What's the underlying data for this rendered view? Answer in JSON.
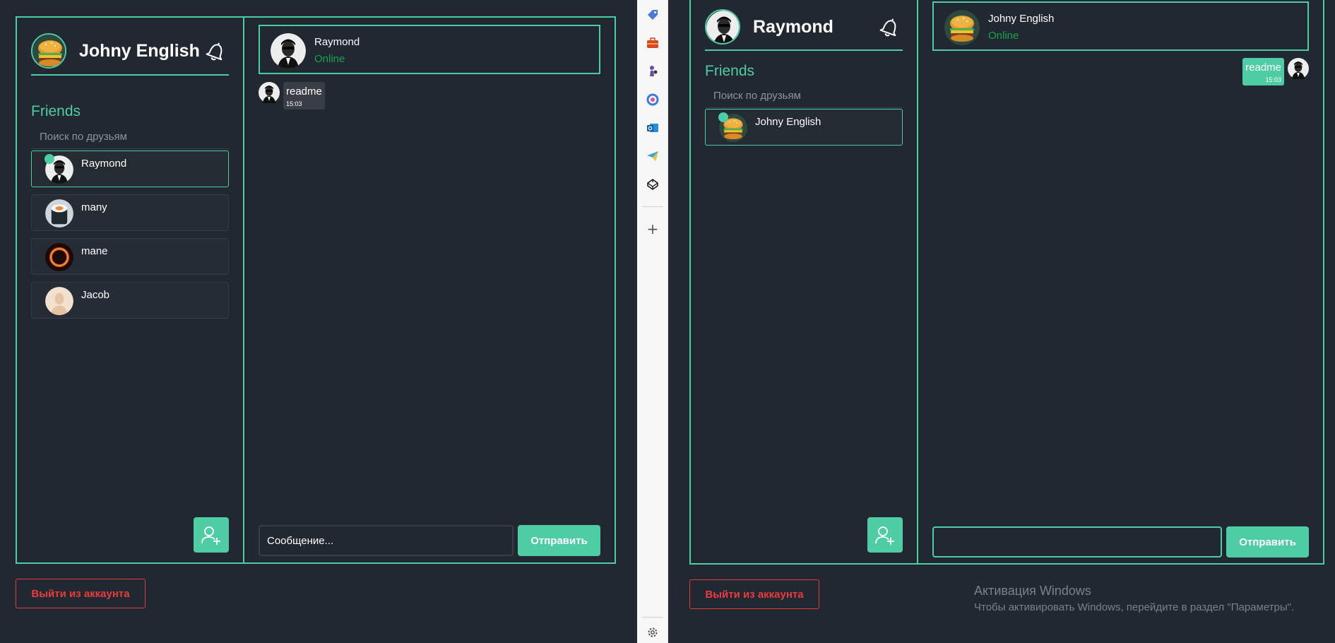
{
  "left": {
    "user_name": "Johny English",
    "friends_title": "Friends",
    "search_placeholder": "Поиск по друзьям",
    "friends": [
      {
        "name": "Raymond",
        "online": true,
        "active": true
      },
      {
        "name": "many",
        "online": false,
        "active": false
      },
      {
        "name": "mane",
        "online": false,
        "active": false
      },
      {
        "name": "Jacob",
        "online": false,
        "active": false
      }
    ],
    "chat": {
      "contact_name": "Raymond",
      "contact_status": "Online",
      "messages": [
        {
          "text": "readme",
          "time": "15:03",
          "direction": "in"
        }
      ],
      "input_placeholder": "Сообщение...",
      "input_value": "",
      "send_label": "Отправить"
    },
    "logout_label": "Выйти из аккаунта"
  },
  "right": {
    "user_name": "Raymond",
    "friends_title": "Friends",
    "search_placeholder": "Поиск по друзьям",
    "friends": [
      {
        "name": "Johny English",
        "online": true,
        "active": true
      }
    ],
    "chat": {
      "contact_name": "Johny English",
      "contact_status": "Online",
      "messages": [
        {
          "text": "readme",
          "time": "15:03",
          "direction": "out"
        }
      ],
      "input_placeholder": "",
      "input_value": "",
      "send_label": "Отправить"
    },
    "logout_label": "Выйти из аккаунта"
  },
  "edge_sidebar": {
    "icons": [
      "tag-icon",
      "toolbox-icon",
      "chess-icon",
      "copilot-icon",
      "outlook-icon",
      "telegram-icon",
      "codepen-icon",
      "add-icon",
      "settings-icon"
    ]
  },
  "windows_activation": {
    "title": "Активация Windows",
    "subtitle": "Чтобы активировать Windows, перейдите в раздел \"Параметры\"."
  },
  "colors": {
    "accent": "#4ecca3",
    "background": "#222831",
    "danger": "#e03c3c",
    "online": "#17a34a"
  }
}
